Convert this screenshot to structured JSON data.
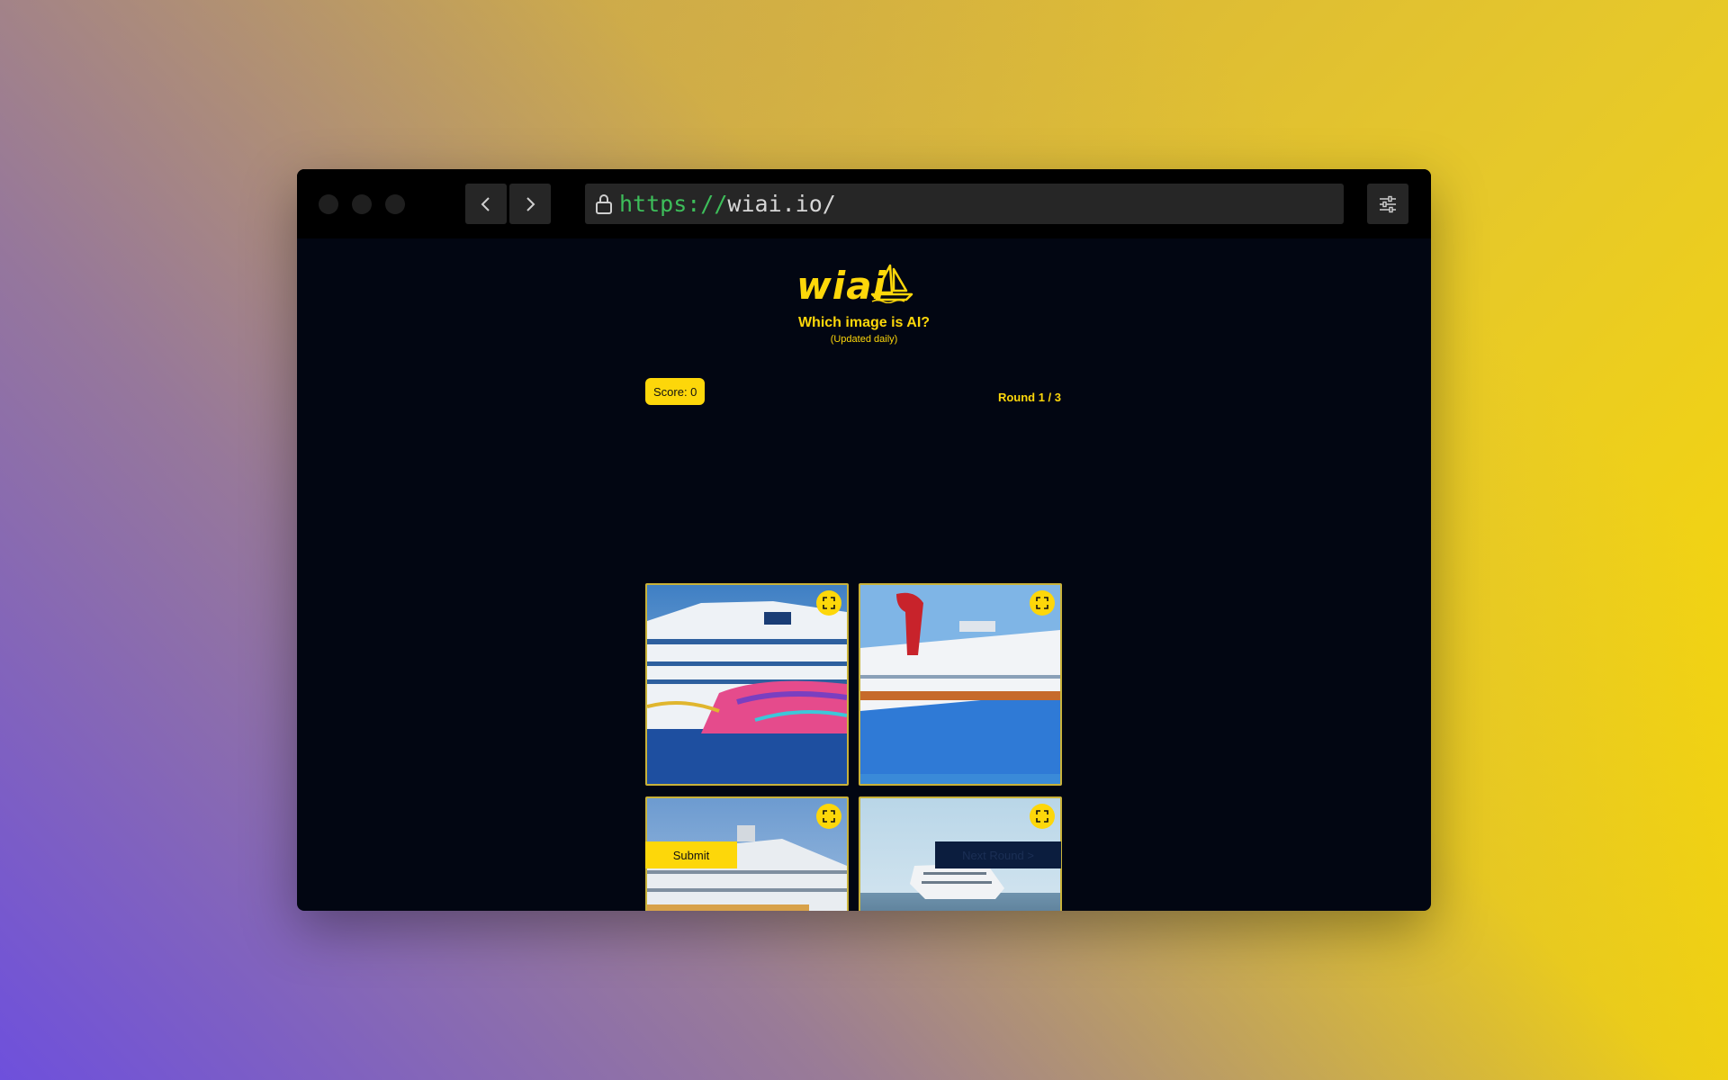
{
  "browser": {
    "url_protocol": "https://",
    "url_host": "wiai.io/"
  },
  "header": {
    "logo_text": "wiai",
    "title": "Which image is AI?",
    "subtitle": "(Updated daily)"
  },
  "game": {
    "score_label": "Score: 0",
    "round_label": "Round 1 / 3",
    "submit_label": "Submit",
    "next_label": "Next Round >"
  },
  "images": [
    {
      "alt": "cruise-ship-colorful-hull"
    },
    {
      "alt": "cruise-ship-red-funnel"
    },
    {
      "alt": "cruise-ship-side-view"
    },
    {
      "alt": "cruise-ship-open-sea"
    }
  ],
  "colors": {
    "accent": "#fdd70a",
    "page_bg": "#020612",
    "url_protocol": "#3dbe5a"
  }
}
